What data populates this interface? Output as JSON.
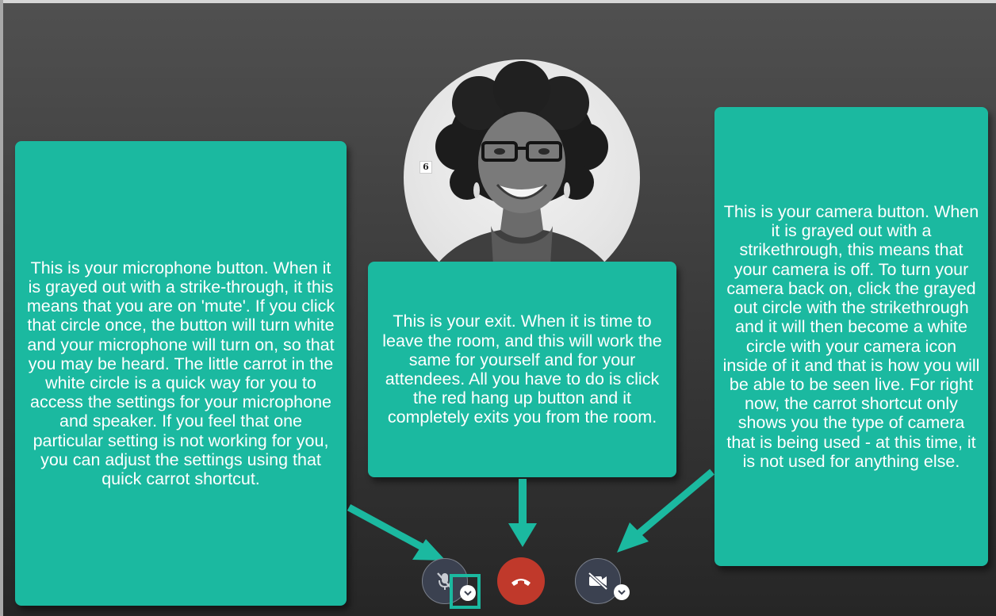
{
  "callouts": {
    "microphone": "This is your microphone button. When it is grayed out with a strike-through, it this means that you are on 'mute'. If you click that circle once, the button will turn white and your microphone will turn on, so that you may be heard. The little carrot in the white circle is a quick way for you to access the settings for your microphone and speaker. If you feel that one particular setting is not working for you, you can adjust the settings using that quick carrot shortcut.",
    "exit": "This is your exit. When it is time to leave the room, and this will work the same for yourself and for your attendees. All you have to do is click the red hang up button and it completely exits you from the room.",
    "camera": "This is your camera button. When it is grayed out with a strikethrough, this means that your camera is off. To turn your camera back on, click the grayed out circle with the strikethrough and it will then become a white circle with your camera icon inside of it and that is how you will be able to be seen live. For right now, the carrot shortcut only shows you the type of camera that is being used - at this time, it is not used for anything else."
  },
  "controls": {
    "microphone": {
      "state": "muted",
      "icon": "microphone-muted-icon"
    },
    "hangup": {
      "icon": "phone-hangup-icon"
    },
    "camera": {
      "state": "off",
      "icon": "camera-off-icon"
    },
    "caret_icon": "chevron-down-icon"
  },
  "colors": {
    "callout": "#1bb9a0",
    "hangup": "#c0392b",
    "control_off": "#3b4150"
  },
  "avatar": {
    "badge": "6"
  }
}
